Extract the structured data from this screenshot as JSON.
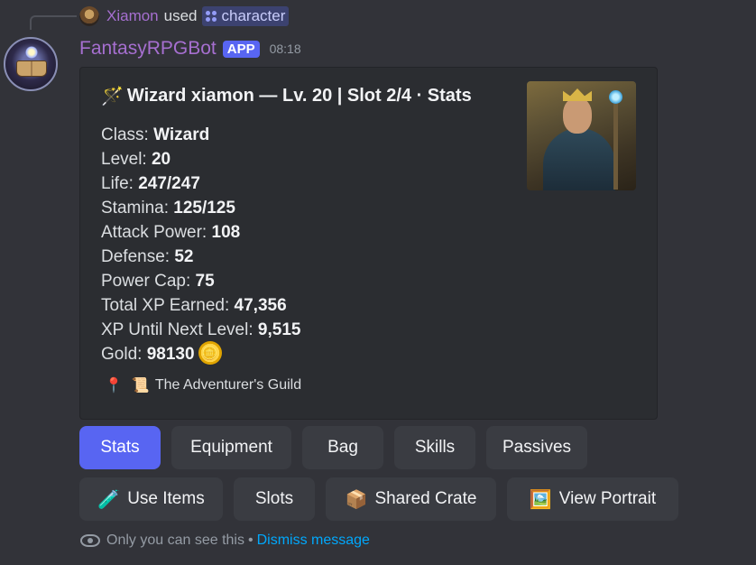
{
  "reply": {
    "user_name": "Xiamon",
    "used_text": "used",
    "command": "character"
  },
  "message": {
    "bot_name": "FantasyRPGBot",
    "badge": "APP",
    "time": "08:18"
  },
  "embed": {
    "title_emoji": "🪄",
    "title": "Wizard xiamon — Lv. 20 | Slot 2/4 · Stats",
    "stats": [
      {
        "label": "Class: ",
        "value": "Wizard"
      },
      {
        "label": "Level: ",
        "value": "20"
      },
      {
        "label": "Life: ",
        "value": "247/247"
      },
      {
        "label": "Stamina: ",
        "value": "125/125"
      },
      {
        "label": "Attack Power: ",
        "value": "108"
      },
      {
        "label": "Defense: ",
        "value": "52"
      },
      {
        "label": "Power Cap: ",
        "value": "75"
      },
      {
        "label": "Total XP Earned: ",
        "value": "47,356"
      },
      {
        "label": "XP Until Next Level: ",
        "value": "9,515"
      },
      {
        "label": "Gold: ",
        "value": "98130"
      }
    ],
    "gold_emoji": "🪙",
    "location_pin": "📍",
    "location_icon": "📜",
    "location": "The Adventurer's Guild"
  },
  "buttons_row1": [
    {
      "label": "Stats"
    },
    {
      "label": "Equipment"
    },
    {
      "label": "Bag"
    },
    {
      "label": "Skills"
    },
    {
      "label": "Passives"
    }
  ],
  "buttons_row2": [
    {
      "emoji": "🧪",
      "label": "Use Items"
    },
    {
      "emoji": "",
      "label": "Slots"
    },
    {
      "emoji": "📦",
      "label": "Shared Crate"
    },
    {
      "emoji": "🖼️",
      "label": "View Portrait"
    }
  ],
  "ephemeral": {
    "text": "Only you can see this",
    "separator": "•",
    "dismiss": "Dismiss message"
  },
  "colors": {
    "background": "#323339",
    "embed": "#2b2d31",
    "accent": "#5865f2",
    "bot_name": "#a66fd0",
    "link": "#00a8fc"
  }
}
